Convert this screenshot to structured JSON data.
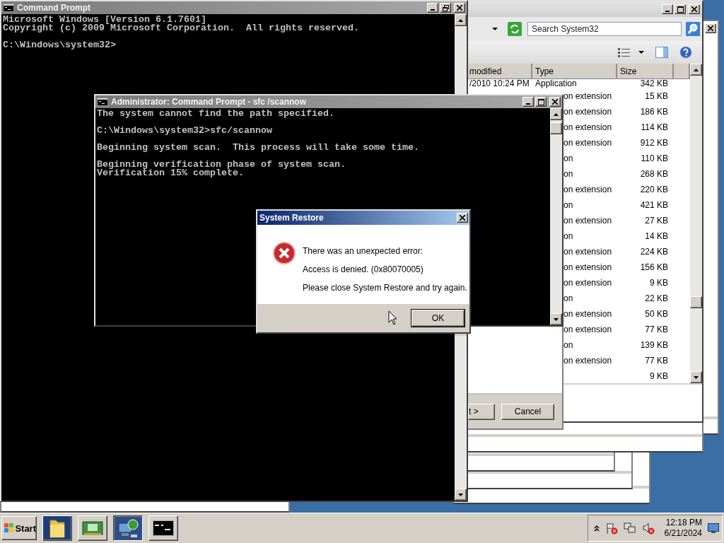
{
  "command_prompt": {
    "title": "Command Prompt",
    "paragraphs": [
      [
        "Microsoft Windows [Version 6.1.7601]",
        "Copyright (c) 2009 Microsoft Corporation.  All rights reserved."
      ],
      [
        "C:\\Windows\\system32>"
      ]
    ]
  },
  "explorer": {
    "search": {
      "placeholder": "Search System32"
    },
    "columns": [
      "modified",
      "Type",
      "Size"
    ],
    "rows": [
      {
        "modified": "/2010 10:24 PM",
        "type": "Application",
        "size": "342 KB"
      },
      {
        "type": "on extension",
        "size": "15 KB"
      },
      {
        "type": "on extension",
        "size": "186 KB"
      },
      {
        "type": "on extension",
        "size": "114 KB"
      },
      {
        "type": "on extension",
        "size": "912 KB"
      },
      {
        "type": "on",
        "size": "110 KB"
      },
      {
        "type": "on",
        "size": "268 KB"
      },
      {
        "type": "on extension",
        "size": "220 KB"
      },
      {
        "type": "on",
        "size": "421 KB"
      },
      {
        "type": "on extension",
        "size": "27 KB"
      },
      {
        "type": "on",
        "size": "14 KB"
      },
      {
        "type": "on extension",
        "size": "224 KB"
      },
      {
        "type": "on extension",
        "size": "156 KB"
      },
      {
        "type": "on extension",
        "size": "9 KB"
      },
      {
        "type": "on",
        "size": "22 KB"
      },
      {
        "type": "on extension",
        "size": "50 KB"
      },
      {
        "type": "on extension",
        "size": "77 KB"
      },
      {
        "type": "on",
        "size": "139 KB"
      },
      {
        "type": "on extension",
        "size": "77 KB"
      },
      {
        "size": "9 KB"
      }
    ]
  },
  "wizard": {
    "buttons": [
      "t >",
      "Cancel"
    ]
  },
  "admin_prompt": {
    "title": "Administrator: Command Prompt - sfc /scannow",
    "paragraphs": [
      [
        "The system cannot find the path specified."
      ],
      [
        "C:\\Windows\\system32>sfc/scannow"
      ],
      [
        "Beginning system scan.  This process will take some time."
      ],
      [
        "Beginning verification phase of system scan.",
        "Verification 15% complete."
      ]
    ]
  },
  "dialog": {
    "title": "System Restore",
    "lines": [
      "There was an unexpected error:",
      "Access is denied. (0x80070005)",
      "Please close System Restore and try again."
    ],
    "buttons": [
      "OK"
    ]
  },
  "taskbar": {
    "start": "Start",
    "tasks": [
      {
        "kind": "folder",
        "selected": false
      },
      {
        "kind": "hardware",
        "selected": false
      },
      {
        "kind": "network",
        "selected": true
      },
      {
        "kind": "console",
        "selected": false
      }
    ],
    "clock": {
      "time": "12:18 PM",
      "date": "6/21/2024"
    }
  }
}
